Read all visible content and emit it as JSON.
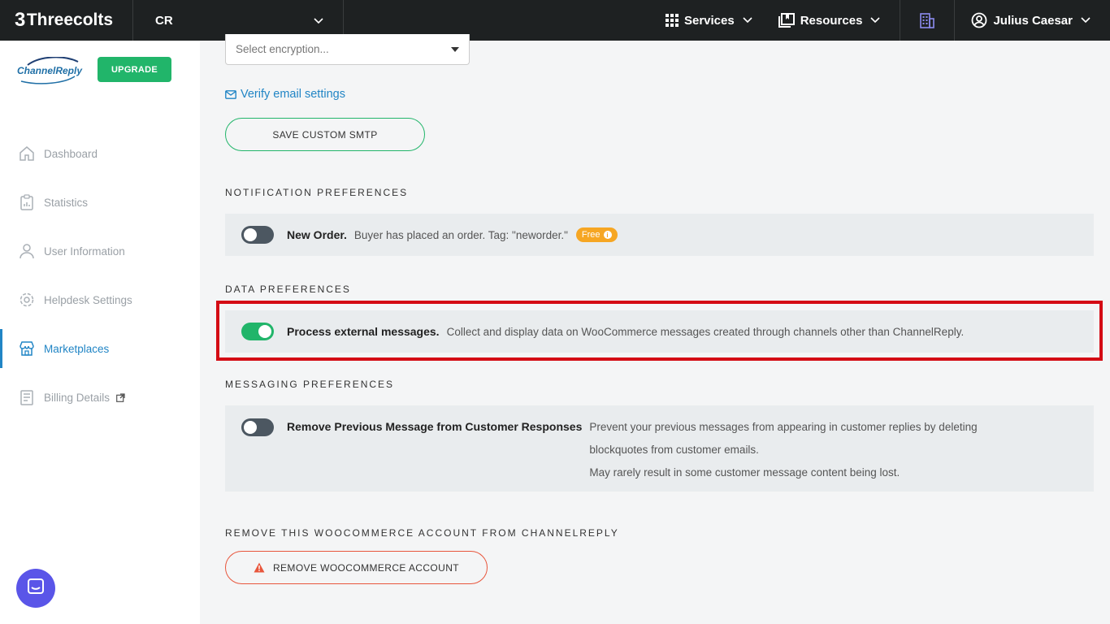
{
  "topbar": {
    "brand_mark": "3",
    "brand_name": "Threecolts",
    "account": "CR",
    "services_label": "Services",
    "resources_label": "Resources",
    "user_name": "Julius Caesar"
  },
  "sidebar": {
    "logo_text": "ChannelReply",
    "upgrade_label": "UPGRADE",
    "items": [
      {
        "label": "Dashboard"
      },
      {
        "label": "Statistics"
      },
      {
        "label": "User Information"
      },
      {
        "label": "Helpdesk Settings"
      },
      {
        "label": "Marketplaces"
      },
      {
        "label": "Billing Details"
      }
    ]
  },
  "main": {
    "encryption_placeholder": "Select encryption...",
    "verify_label": "Verify email settings",
    "save_smtp_label": "SAVE CUSTOM SMTP",
    "notification_title": "NOTIFICATION PREFERENCES",
    "new_order": {
      "label": "New Order.",
      "desc": "Buyer has placed an order. Tag: \"neworder.\"",
      "badge": "Free",
      "enabled": false
    },
    "data_title": "DATA PREFERENCES",
    "process_external": {
      "label": "Process external messages.",
      "desc": "Collect and display data on WooCommerce messages created through channels other than ChannelReply.",
      "enabled": true
    },
    "messaging_title": "MESSAGING PREFERENCES",
    "remove_previous": {
      "label": "Remove Previous Message from Customer Responses",
      "desc1": "Prevent your previous messages from appearing in customer replies by deleting",
      "desc2": "blockquotes from customer emails.",
      "desc3": "May rarely result in some customer message content being lost.",
      "enabled": false
    },
    "remove_title": "REMOVE THIS WOOCOMMERCE ACCOUNT FROM CHANNELREPLY",
    "remove_label": "REMOVE WOOCOMMERCE ACCOUNT"
  },
  "colors": {
    "accent_green": "#21b56a",
    "link_blue": "#2185c5",
    "highlight_red": "#d40b14",
    "topbar_bg": "#1e2122"
  }
}
